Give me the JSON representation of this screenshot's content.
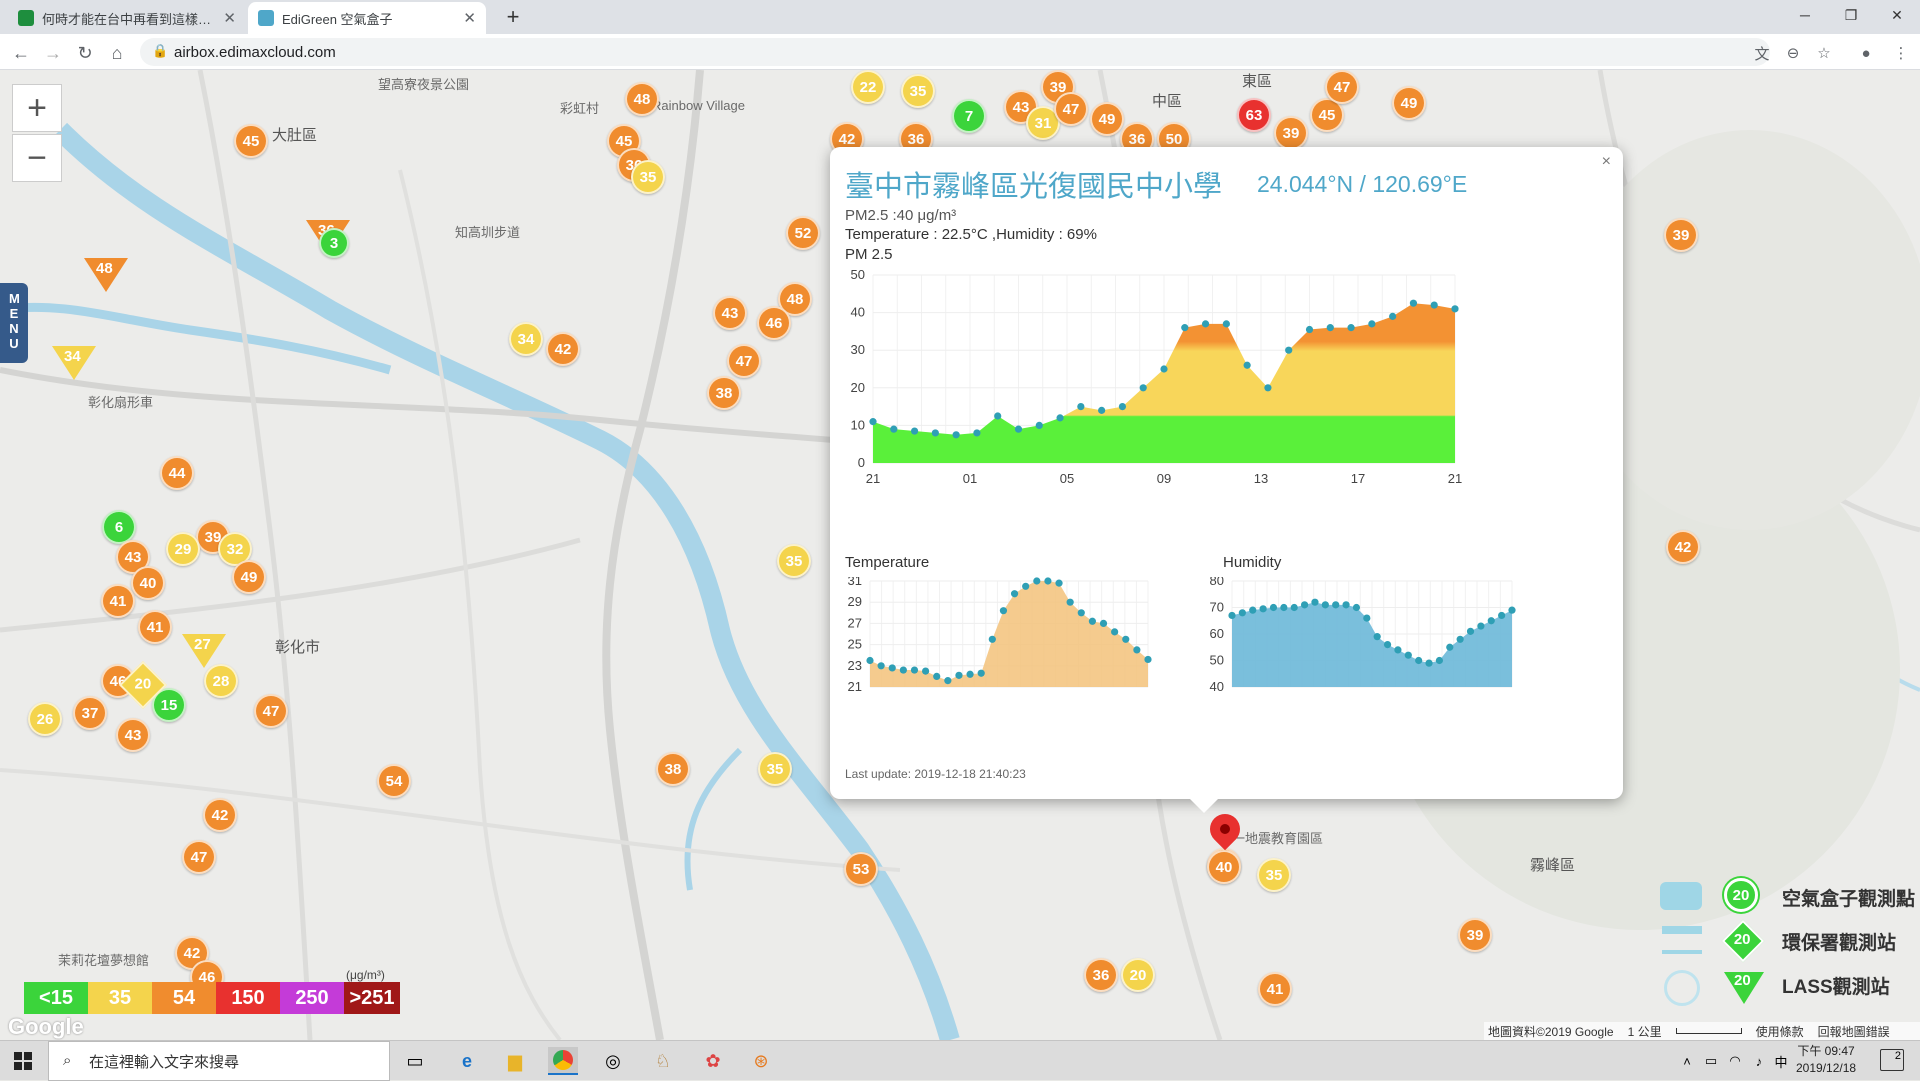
{
  "browser": {
    "tabs": [
      {
        "label": "何時才能在台中再看到這樣的藍天",
        "active": false
      },
      {
        "label": "EdiGreen 空氣盒子",
        "active": true
      }
    ],
    "url": "airbox.edimaxcloud.com",
    "new_tab": "+",
    "close_glyph": "✕"
  },
  "map": {
    "place_labels": [
      {
        "text": "大肚區"
      },
      {
        "text": "望高寮夜景公園"
      },
      {
        "text": "彩虹村"
      },
      {
        "text": "Rainbow Village"
      },
      {
        "text": "中區"
      },
      {
        "text": "東區"
      },
      {
        "text": "知高圳步道"
      },
      {
        "text": "彰化扇形車"
      },
      {
        "text": "彰化市"
      },
      {
        "text": "霧峰區"
      },
      {
        "text": "一地震教育園區"
      },
      {
        "text": "茉莉花壇夢想館"
      }
    ],
    "markers": [
      {
        "v": "45",
        "c": "o"
      },
      {
        "v": "48",
        "c": "o"
      },
      {
        "v": "45",
        "c": "o"
      },
      {
        "v": "36",
        "c": "o"
      },
      {
        "v": "35",
        "c": "y"
      },
      {
        "v": "22",
        "c": "y"
      },
      {
        "v": "35",
        "c": "y"
      },
      {
        "v": "39",
        "c": "o"
      },
      {
        "v": "43",
        "c": "o"
      },
      {
        "v": "31",
        "c": "y"
      },
      {
        "v": "47",
        "c": "o"
      },
      {
        "v": "49",
        "c": "o"
      },
      {
        "v": "36",
        "c": "o"
      },
      {
        "v": "50",
        "c": "o"
      },
      {
        "v": "7",
        "c": "g"
      },
      {
        "v": "42",
        "c": "o"
      },
      {
        "v": "36",
        "c": "o"
      },
      {
        "v": "63",
        "c": "r"
      },
      {
        "v": "39",
        "c": "o"
      },
      {
        "v": "45",
        "c": "o"
      },
      {
        "v": "47",
        "c": "o"
      },
      {
        "v": "49",
        "c": "o"
      },
      {
        "v": "52",
        "c": "o"
      },
      {
        "v": "48",
        "c": "o"
      },
      {
        "v": "43",
        "c": "o"
      },
      {
        "v": "46",
        "c": "o"
      },
      {
        "v": "47",
        "c": "o"
      },
      {
        "v": "38",
        "c": "o"
      },
      {
        "v": "34",
        "c": "y"
      },
      {
        "v": "42",
        "c": "o"
      },
      {
        "v": "44",
        "c": "o"
      },
      {
        "v": "6",
        "c": "g"
      },
      {
        "v": "39",
        "c": "o"
      },
      {
        "v": "43",
        "c": "o"
      },
      {
        "v": "29",
        "c": "y"
      },
      {
        "v": "32",
        "c": "y"
      },
      {
        "v": "40",
        "c": "o"
      },
      {
        "v": "49",
        "c": "o"
      },
      {
        "v": "41",
        "c": "o"
      },
      {
        "v": "41",
        "c": "o"
      },
      {
        "v": "46",
        "c": "o"
      },
      {
        "v": "28",
        "c": "y"
      },
      {
        "v": "15",
        "c": "g"
      },
      {
        "v": "26",
        "c": "y"
      },
      {
        "v": "37",
        "c": "o"
      },
      {
        "v": "43",
        "c": "o"
      },
      {
        "v": "47",
        "c": "o"
      },
      {
        "v": "35",
        "c": "y"
      },
      {
        "v": "54",
        "c": "o"
      },
      {
        "v": "38",
        "c": "o"
      },
      {
        "v": "35",
        "c": "y"
      },
      {
        "v": "42",
        "c": "o"
      },
      {
        "v": "47",
        "c": "o"
      },
      {
        "v": "42",
        "c": "o"
      },
      {
        "v": "46",
        "c": "o"
      },
      {
        "v": "53",
        "c": "o"
      },
      {
        "v": "40",
        "c": "o"
      },
      {
        "v": "35",
        "c": "y"
      },
      {
        "v": "36",
        "c": "o"
      },
      {
        "v": "20",
        "c": "y"
      },
      {
        "v": "41",
        "c": "o"
      },
      {
        "v": "39",
        "c": "o"
      },
      {
        "v": "39",
        "c": "o"
      },
      {
        "v": "42",
        "c": "o"
      }
    ],
    "triangles": [
      {
        "v": "48",
        "c": "o"
      },
      {
        "v": "34",
        "c": "y"
      },
      {
        "v": "36",
        "c": "o"
      },
      {
        "v": "27",
        "c": "y"
      }
    ],
    "diamond": {
      "v": "20",
      "c": "y"
    },
    "green_dot": {
      "v": "3"
    },
    "zoom_in": "+",
    "zoom_out": "−",
    "menu_label": "MENU",
    "legend": [
      {
        "label": "<15",
        "color": "#3bd43b"
      },
      {
        "label": "35",
        "color": "#f4d44c"
      },
      {
        "label": "54",
        "color": "#f08c2e"
      },
      {
        "label": "150",
        "color": "#e8312f"
      },
      {
        "label": "250",
        "color": "#c43bd8"
      },
      {
        "label": ">251",
        "color": "#a01818"
      }
    ],
    "legend_unit": "(μg/m³)",
    "google_logo": "Google",
    "station_legend": [
      {
        "num": "20",
        "label": "空氣盒子觀測點"
      },
      {
        "num": "20",
        "label": "環保署觀測站"
      },
      {
        "num": "20",
        "label": "LASS觀測站"
      }
    ],
    "attribution": "地圖資料©2019 Google",
    "scale": "1 公里",
    "terms": "使用條款",
    "report": "回報地圖錯誤"
  },
  "popup": {
    "title": "臺中市霧峰區光復國民中小學",
    "coords": "24.044°N / 120.69°E",
    "pm_line": "PM2.5 :40 μg/m³",
    "temp_line": "Temperature : 22.5°C ,Humidity : 69%",
    "pm_title": "PM 2.5",
    "temp_title": "Temperature",
    "hum_title": "Humidity",
    "last_update": "Last update: 2019-12-18 21:40:23",
    "close": "×",
    "marker_value": "40"
  },
  "chart_data": [
    {
      "type": "area",
      "title": "PM 2.5",
      "x_ticks": [
        "21",
        "01",
        "05",
        "09",
        "13",
        "17",
        "21"
      ],
      "ylim": [
        0,
        50
      ],
      "y_ticks": [
        0,
        10,
        20,
        30,
        40,
        50
      ],
      "colors": {
        "low": "#5af03a",
        "mid": "#f8d65a",
        "high": "#f39233"
      },
      "values": [
        11,
        9,
        8.5,
        8,
        7.5,
        8,
        12.5,
        9,
        10,
        12,
        15,
        14,
        15,
        20,
        25,
        36,
        37,
        37,
        26,
        20,
        30,
        35.5,
        36,
        36,
        37,
        39,
        42.5,
        42,
        41
      ]
    },
    {
      "type": "area",
      "title": "Temperature",
      "ylim": [
        21,
        31
      ],
      "y_ticks": [
        21,
        23,
        25,
        27,
        29,
        31
      ],
      "color": "#f3c27a",
      "values": [
        23.5,
        23,
        22.8,
        22.6,
        22.6,
        22.5,
        22,
        21.6,
        22.1,
        22.2,
        22.3,
        25.5,
        28.2,
        29.8,
        30.5,
        31,
        31,
        30.8,
        29,
        28,
        27.2,
        27,
        26.2,
        25.5,
        24.5,
        23.6
      ]
    },
    {
      "type": "area",
      "title": "Humidity",
      "ylim": [
        40,
        80
      ],
      "y_ticks": [
        40,
        50,
        60,
        70,
        80
      ],
      "color": "#6cb8d8",
      "values": [
        67,
        68,
        69,
        69.5,
        70,
        70,
        70,
        71,
        72,
        71,
        71,
        71,
        70,
        66,
        59,
        56,
        54,
        52,
        50,
        49,
        50,
        55,
        58,
        61,
        63,
        65,
        67,
        69
      ]
    }
  ],
  "taskbar": {
    "search_placeholder": "在這裡輸入文字來搜尋",
    "time": "下午 09:47",
    "date": "2019/12/18",
    "ime": "中",
    "notif": "2"
  }
}
